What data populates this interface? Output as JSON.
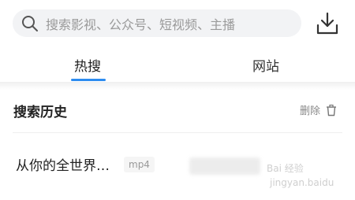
{
  "search": {
    "placeholder": "搜索影视、公众号、短视频、主播"
  },
  "icons": {
    "search": "search-icon",
    "download": "download-icon",
    "trash": "trash-icon"
  },
  "tabs": [
    {
      "label": "热搜",
      "active": true
    },
    {
      "label": "网站",
      "active": false
    }
  ],
  "history": {
    "title": "搜索历史",
    "delete_label": "删除",
    "items": [
      {
        "text": "从你的全世界…",
        "tag": "mp4"
      }
    ]
  },
  "watermark": {
    "text": "Bai 经验",
    "sub": "jingyan.baidu.com"
  },
  "colors": {
    "accent": "#2d8cf0",
    "text": "#222222",
    "muted": "#999999"
  }
}
